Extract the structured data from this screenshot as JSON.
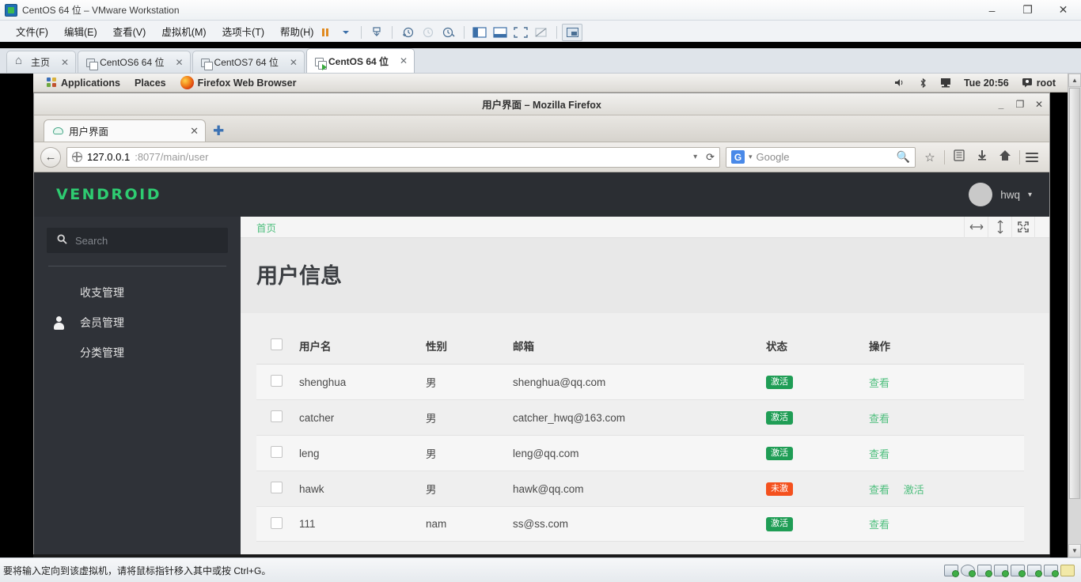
{
  "vmware": {
    "title": "CentOS 64 位 – VMware Workstation",
    "window_buttons": [
      "–",
      "❐",
      "✕"
    ],
    "menus": [
      "文件(F)",
      "编辑(E)",
      "查看(V)",
      "虚拟机(M)",
      "选项卡(T)",
      "帮助(H)"
    ],
    "toolbar_icons": [
      "pause-icon",
      "dropdown-caret-icon",
      "snapshot-manager-icon",
      "take-snapshot-icon",
      "revert-snapshot-icon",
      "manage-snapshot-icon",
      "show-library-icon",
      "show-thumbnail-bar-icon",
      "full-screen-icon",
      "unity-mode-icon",
      "console-view-icon"
    ],
    "tabs": [
      {
        "label": "主页",
        "icon": "home-icon",
        "active": false
      },
      {
        "label": "CentOS6 64 位",
        "icon": "vm-icon",
        "active": false
      },
      {
        "label": "CentOS7 64 位",
        "icon": "vm-icon",
        "active": false
      },
      {
        "label": "CentOS 64 位",
        "icon": "vm-running-icon",
        "active": true
      }
    ],
    "status_message": "要将输入定向到该虚拟机，请将鼠标指针移入其中或按 Ctrl+G。",
    "status_icons": [
      "harddisk-icon",
      "cd-icon",
      "network-icon",
      "printer-icon",
      "usb-icon",
      "sound-icon",
      "display-icon",
      "note-icon"
    ]
  },
  "gnome": {
    "applications": "Applications",
    "places": "Places",
    "current_app": "Firefox Web Browser",
    "clock": "Tue 20:56",
    "user": "root",
    "tray_icons": [
      "volume-icon",
      "bluetooth-icon",
      "display-icon"
    ]
  },
  "firefox": {
    "window_title": "用户界面 – Mozilla Firefox",
    "window_buttons": [
      "_",
      "❐",
      "✕"
    ],
    "tab": {
      "label": "用户界面",
      "close": "✕",
      "favicon": "cloud-icon"
    },
    "new_tab": "✚",
    "url": {
      "host": "127.0.0.1",
      "rest": ":8077/main/user"
    },
    "search": {
      "engine": "G",
      "placeholder": "Google"
    },
    "nav_icons": [
      "back-icon",
      "reload-icon",
      "bookmark-star-icon",
      "reading-list-icon",
      "downloads-icon",
      "home-icon",
      "menu-icon"
    ]
  },
  "app": {
    "logo": "VENDROID",
    "user": {
      "name": "hwq",
      "caret": "▾"
    },
    "sidebar": {
      "search_placeholder": "Search",
      "search_value": "",
      "items": [
        {
          "label": "收支管理",
          "icon": "shield-icon"
        },
        {
          "label": "会员管理",
          "icon": "user-icon"
        },
        {
          "label": "分类管理",
          "icon": "file-icon"
        }
      ]
    },
    "breadcrumb": "首页",
    "content_tools": [
      "resize-horizontal-icon",
      "resize-vertical-icon",
      "expand-fullscreen-icon"
    ],
    "page_title": "用户信息",
    "table": {
      "columns": [
        "",
        "用户名",
        "性别",
        "邮箱",
        "状态",
        "操作"
      ],
      "rows": [
        {
          "user": "shenghua",
          "sex": "男",
          "email": "shenghua@qq.com",
          "status": "激活",
          "status_type": "green",
          "actions": [
            "查看"
          ]
        },
        {
          "user": "catcher",
          "sex": "男",
          "email": "catcher_hwq@163.com",
          "status": "激活",
          "status_type": "green",
          "actions": [
            "查看"
          ]
        },
        {
          "user": "leng",
          "sex": "男",
          "email": "leng@qq.com",
          "status": "激活",
          "status_type": "green",
          "actions": [
            "查看"
          ]
        },
        {
          "user": "hawk",
          "sex": "男",
          "email": "hawk@qq.com",
          "status": "未激",
          "status_type": "orange",
          "actions": [
            "查看",
            "激活"
          ]
        },
        {
          "user": "111",
          "sex": "nam",
          "email": "ss@ss.com",
          "status": "激活",
          "status_type": "green",
          "actions": [
            "查看"
          ]
        }
      ]
    },
    "colors": {
      "accent_green": "#4fbf7e",
      "logo_green": "#2ecc71",
      "badge_green": "#1f9d55",
      "badge_orange": "#f4511e",
      "header_dark": "#2b2e33",
      "sidebar_dark": "#2f3238"
    }
  }
}
